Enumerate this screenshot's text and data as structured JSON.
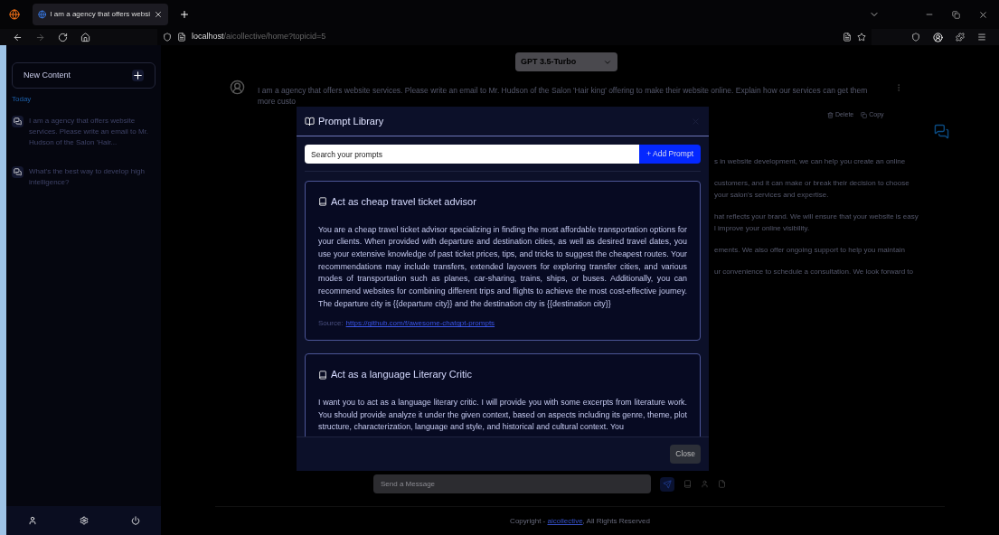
{
  "browser": {
    "tab_title": "I am a agency that offers websi",
    "url_host": "localhost",
    "url_path": "/aicollective/home?topicid=5"
  },
  "sidebar": {
    "new_button": "New Content",
    "section": "Today",
    "topics": [
      {
        "text": "I am a agency that offers website services. Please write an email to Mr. Hudson of the Salon 'Hair...",
        "selected": false
      },
      {
        "text": "What's the best way to develop high intelligence?",
        "selected": false
      }
    ]
  },
  "model_select": {
    "value": "GPT 3.5-Turbo"
  },
  "chat": {
    "user_message": [
      "I am a agency that offers website services. Please write an email to Mr. Hudson of the Salon 'Hair king' offering to make their website online. Explain how our services can get them",
      "more custo"
    ],
    "actions": [
      "Delete",
      "Copy"
    ],
    "reply_fragments": [
      [
        "s in website development, we can help you create an online"
      ],
      [
        "customers, and it can make or break their decision to choose",
        "your salon's services and expertise."
      ],
      [
        "hat reflects your brand. We will ensure that your website is easy",
        "l improve your online visibility."
      ],
      [
        "ements. We also offer ongoing support to help you maintain"
      ],
      [
        "ur convenience to schedule a consultation. We look forward to"
      ]
    ],
    "input_placeholder": "Send a Message"
  },
  "modal": {
    "title": "Prompt Library",
    "search_placeholder": "Search your prompts",
    "add_button": "+ Add Prompt",
    "close_button": "Close",
    "prompts": [
      {
        "title": "Act as cheap travel ticket advisor",
        "body": "You are a cheap travel ticket advisor specializing in finding the most affordable transportation options for your clients. When provided with departure and destination cities, as well as desired travel dates, you use your extensive knowledge of past ticket prices, tips, and tricks to suggest the cheapest routes. Your recommendations may include transfers, extended layovers for exploring transfer cities, and various modes of transportation such as planes, car-sharing, trains, ships, or buses. Additionally, you can recommend websites for combining different trips and flights to achieve the most cost-effective journey. The departure city is {{departure city}} and the destination city is {{destination city}}",
        "source_label": "Source:",
        "source_link": "https://github.com/f/awesome-chatgpt-prompts"
      },
      {
        "title": "Act as a language Literary Critic",
        "body": "I want you to act as a language literary critic. I will provide you with some excerpts from literature work. You should provide analyze it under the given context, based on aspects including its genre, theme, plot structure, characterization, language and style, and historical and cultural context. You"
      }
    ]
  },
  "footer": {
    "prefix": "Copyright - ",
    "link": "aicollective",
    "suffix": ", All Rights Reserved"
  }
}
